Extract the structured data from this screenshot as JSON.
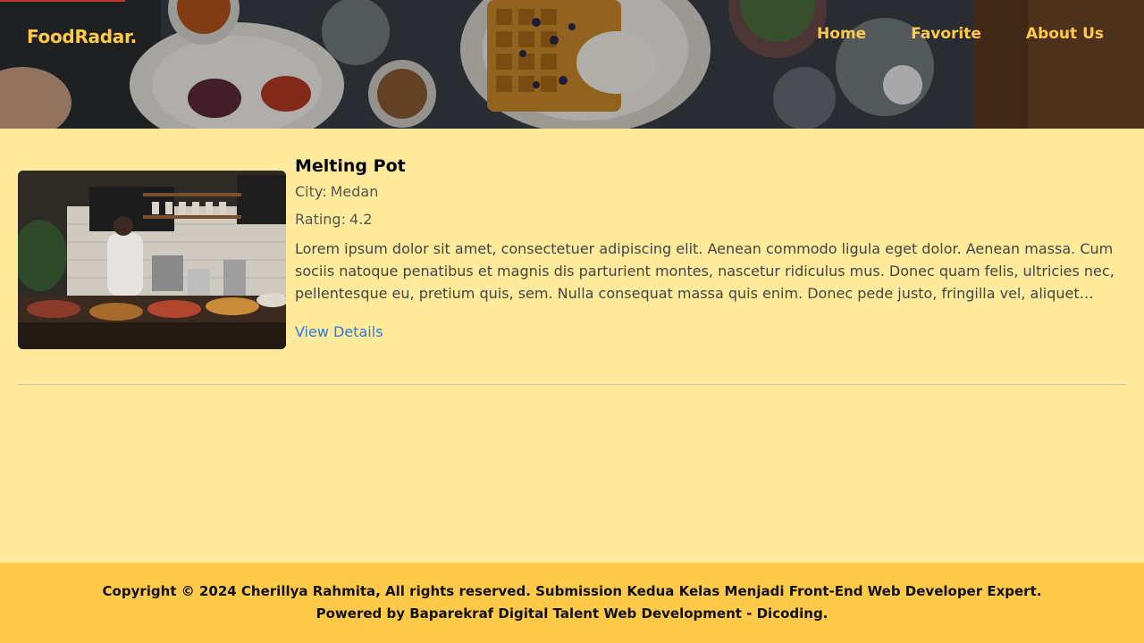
{
  "colors": {
    "accent": "#ffc94a",
    "page_bg": "#ffeb9b",
    "footer_bg": "#ffc94a",
    "link": "#2a7ae2",
    "brand_text": "#ffc94a",
    "nav_text": "#ffc94a"
  },
  "header": {
    "brand": "FoodRadar.",
    "nav": [
      {
        "label": "Home"
      },
      {
        "label": "Favorite"
      },
      {
        "label": "About Us"
      }
    ]
  },
  "restaurants": [
    {
      "name": "Melting Pot",
      "city_label": "City:",
      "city": "Medan",
      "rating_label": "Rating:",
      "rating": "4.2",
      "description": "Lorem ipsum dolor sit amet, consectetuer adipiscing elit. Aenean commodo ligula eget dolor. Aenean massa. Cum sociis natoque penatibus et magnis dis parturient montes, nascetur ridiculus mus. Donec quam felis, ultricies nec, pellentesque eu, pretium quis, sem. Nulla consequat massa quis enim. Donec pede justo, fringilla vel, aliquet nec,...",
      "details_label": "View Details"
    }
  ],
  "footer": {
    "line1": "Copyright © 2024 Cherillya Rahmita, All rights reserved. Submission Kedua Kelas Menjadi Front-End Web Developer Expert.",
    "line2": "Powered by Baparekraf Digital Talent Web Development - Dicoding."
  }
}
